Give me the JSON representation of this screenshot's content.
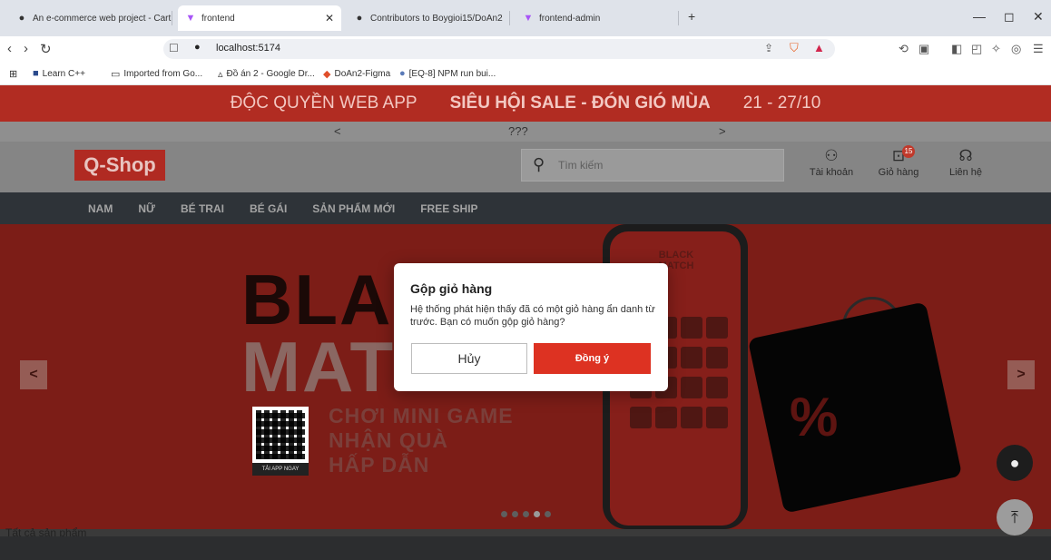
{
  "browser": {
    "tabs": [
      {
        "title": "An e-commerce web project - Cart in",
        "icon": "github-icon"
      },
      {
        "title": "frontend",
        "icon": "vite-icon",
        "active": true
      },
      {
        "title": "Contributors to Boygioi15/DoAn2",
        "icon": "github-icon"
      },
      {
        "title": "frontend-admin",
        "icon": "vite-icon"
      }
    ],
    "url": "localhost:5174",
    "bookmarks": [
      "Learn C++",
      "Imported from Go...",
      "Đồ án 2 - Google Dr...",
      "DoAn2-Figma",
      "[EQ-8] NPM run bui..."
    ]
  },
  "promo": {
    "left": "ĐỘC QUYỀN WEB APP",
    "center": "SIÊU HỘI SALE - ĐÓN GIÓ MÙA",
    "right": "21 - 27/10"
  },
  "strip": {
    "prev": "<",
    "text": "???",
    "next": ">"
  },
  "header": {
    "logo": "Q-Shop",
    "search_placeholder": "Tìm kiếm",
    "account": "Tài khoản",
    "cart": "Giỏ hàng",
    "cart_count": "15",
    "contact": "Liên hệ"
  },
  "menu": [
    "NAM",
    "NỮ",
    "BÉ TRAI",
    "BÉ GÁI",
    "SẢN PHẨM MỚI",
    "FREE SHIP"
  ],
  "banner": {
    "line1": "BLA",
    "line2": "MAT",
    "phone_title": "BLACK MATCH",
    "qr_label": "TẢI APP NGAY",
    "game1": "CHƠI MINI GAME",
    "game2": "NHẬN QUÀ",
    "game3": "HẤP DẪN",
    "prev": "<",
    "next": ">",
    "slides": 5,
    "active_slide": 4
  },
  "all_products": "Tất cả sản phẩm",
  "modal": {
    "title": "Gộp giỏ hàng",
    "message": "Hệ thống phát hiện thấy đã có một giỏ hàng ẩn danh từ trước. Bạn có muốn gộp giỏ hàng?",
    "cancel": "Hủy",
    "confirm": "Đồng ý"
  },
  "colors": {
    "accent": "#dd3222",
    "menu_bg": "#2e3338"
  }
}
